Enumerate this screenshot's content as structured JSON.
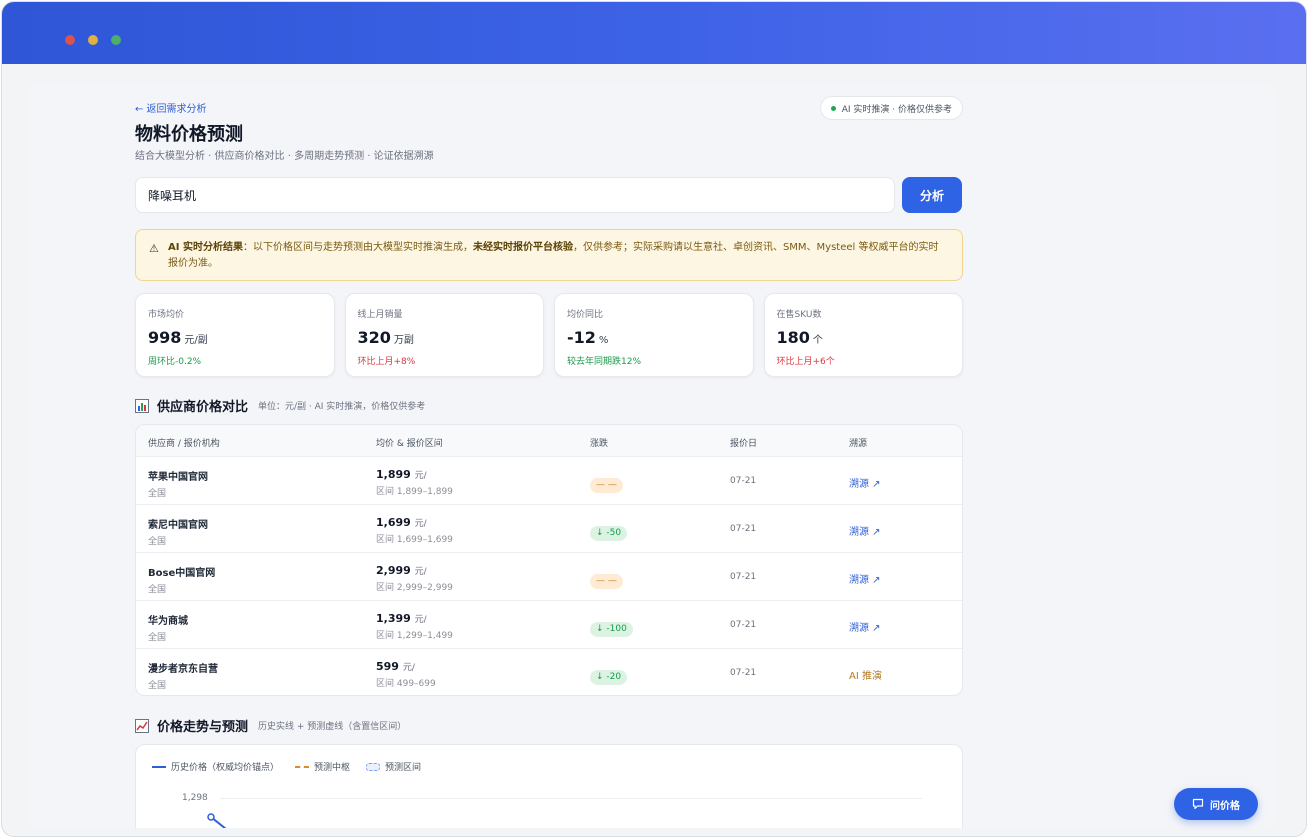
{
  "header": {
    "back_link": "← 返回需求分析",
    "ai_badge": "AI 实时推演 · 价格仅供参考",
    "title": "物料价格预测",
    "subtitle": "结合大模型分析 · 供应商价格对比 · 多周期走势预测 · 论证依据溯源"
  },
  "search": {
    "value": "降噪耳机",
    "button_label": "分析"
  },
  "warning": {
    "lead": "AI 实时分析结果",
    "text1": "：以下价格区间与走势预测由大模型实时推演生成，",
    "bold2": "未经实时报价平台核验",
    "text2": "，仅供参考；实际采购请以生意社、卓创资讯、SMM、Mysteel 等权威平台的实时报价为准。"
  },
  "stats": [
    {
      "label": "市场均价",
      "value": "998",
      "unit": "元/副",
      "change": "周环比-0.2%",
      "tone": "green"
    },
    {
      "label": "线上月销量",
      "value": "320",
      "unit": "万副",
      "change": "环比上月+8%",
      "tone": "red"
    },
    {
      "label": "均价同比",
      "value": "-12",
      "unit": "%",
      "change": "较去年同期跌12%",
      "tone": "green"
    },
    {
      "label": "在售SKU数",
      "value": "180",
      "unit": "个",
      "change": "环比上月+6个",
      "tone": "red"
    }
  ],
  "supplier_section": {
    "title": "供应商价格对比",
    "note": "单位：元/副 · AI 实时推演，价格仅供参考",
    "columns": [
      "供应商 / 报价机构",
      "均价 & 报价区间",
      "涨跌",
      "报价日",
      "溯源"
    ],
    "rows": [
      {
        "name": "苹果中国官网",
        "region": "全国",
        "price": "1,899",
        "unit": "元/",
        "range": "区间 1,899–1,899",
        "change": "— —",
        "change_type": "flat",
        "date": "07-21",
        "source": "溯源 ↗",
        "source_type": "link"
      },
      {
        "name": "索尼中国官网",
        "region": "全国",
        "price": "1,699",
        "unit": "元/",
        "range": "区间 1,699–1,699",
        "change": "↓ -50",
        "change_type": "down",
        "date": "07-21",
        "source": "溯源 ↗",
        "source_type": "link"
      },
      {
        "name": "Bose中国官网",
        "region": "全国",
        "price": "2,999",
        "unit": "元/",
        "range": "区间 2,999–2,999",
        "change": "— —",
        "change_type": "flat",
        "date": "07-21",
        "source": "溯源 ↗",
        "source_type": "link"
      },
      {
        "name": "华为商城",
        "region": "全国",
        "price": "1,399",
        "unit": "元/",
        "range": "区间 1,299–1,499",
        "change": "↓ -100",
        "change_type": "down",
        "date": "07-21",
        "source": "溯源 ↗",
        "source_type": "link"
      },
      {
        "name": "漫步者京东自营",
        "region": "全国",
        "price": "599",
        "unit": "元/",
        "range": "区间 499–699",
        "change": "↓ -20",
        "change_type": "down",
        "date": "07-21",
        "source": "AI 推演",
        "source_type": "ai"
      }
    ]
  },
  "trend_section": {
    "title": "价格走势与预测",
    "note": "历史实线 + 预测虚线（含置信区间）",
    "legend": [
      "历史价格（权威均价锚点）",
      "预测中枢",
      "预测区间"
    ],
    "y_tick": "1,298"
  },
  "fab": {
    "label": "问价格"
  },
  "colors": {
    "accent": "#2f63e6",
    "up": "#d9363e",
    "down": "#1a9a4b",
    "flat": "#d97706"
  }
}
